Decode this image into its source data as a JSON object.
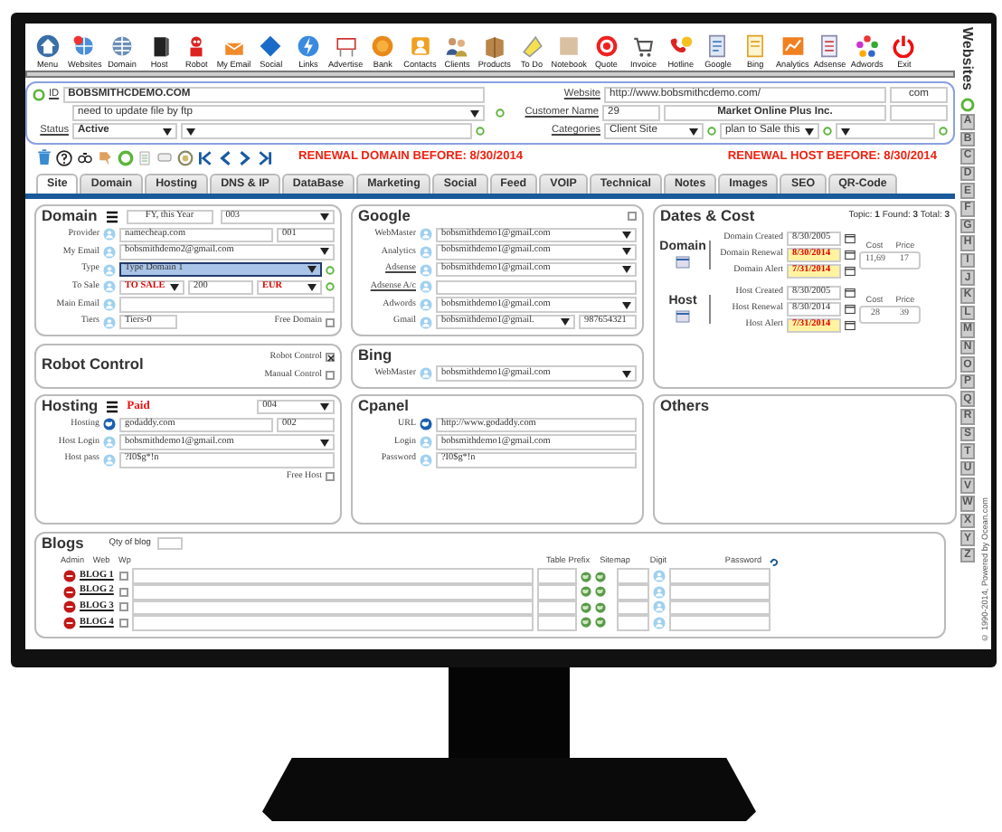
{
  "toolbar": [
    {
      "label": "Menu"
    },
    {
      "label": "Websites"
    },
    {
      "label": "Domain"
    },
    {
      "label": "Host"
    },
    {
      "label": "Robot"
    },
    {
      "label": "My Email"
    },
    {
      "label": "Social"
    },
    {
      "label": "Links"
    },
    {
      "label": "Advertise"
    },
    {
      "label": "Bank"
    },
    {
      "label": "Contacts"
    },
    {
      "label": "Clients"
    },
    {
      "label": "Products"
    },
    {
      "label": "To Do"
    },
    {
      "label": "Notebook"
    },
    {
      "label": "Quote"
    },
    {
      "label": "Invoice"
    },
    {
      "label": "Hotline"
    },
    {
      "label": "Google"
    },
    {
      "label": "Bing"
    },
    {
      "label": "Analytics"
    },
    {
      "label": "Adsense"
    },
    {
      "label": "Adwords"
    },
    {
      "label": "Exit"
    }
  ],
  "header": {
    "id_label": "ID",
    "id": "BOBSMITHCDEMO.COM",
    "note": "need to update file by ftp",
    "status_label": "Status",
    "status": "Active",
    "website_label": "Website",
    "website": "http://www.bobsmithcdemo.com/",
    "tld": "com",
    "customer_label": "Customer Name",
    "customer_no": "29",
    "customer": "Market Online Plus Inc.",
    "categories_label": "Categories",
    "category_1": "Client Site",
    "category_2": "plan to Sale this",
    "side_tab": "Websites"
  },
  "renewal_domain": "RENEWAL DOMAIN BEFORE: 8/30/2014",
  "renewal_host": "RENEWAL HOST BEFORE: 8/30/2014",
  "tabs": [
    {
      "label": "Site",
      "selected": true
    },
    {
      "label": "Domain",
      "selected": false
    },
    {
      "label": "Hosting",
      "selected": false
    },
    {
      "label": "DNS & IP",
      "selected": false
    },
    {
      "label": "DataBase",
      "selected": false
    },
    {
      "label": "Marketing",
      "selected": false
    },
    {
      "label": "Social",
      "selected": false
    },
    {
      "label": "Feed",
      "selected": false
    },
    {
      "label": "VOIP",
      "selected": false
    },
    {
      "label": "Technical",
      "selected": false
    },
    {
      "label": "Notes",
      "selected": false
    },
    {
      "label": "Images",
      "selected": false
    },
    {
      "label": "SEO",
      "selected": false
    },
    {
      "label": "QR-Code",
      "selected": false
    }
  ],
  "domain": {
    "title": "Domain",
    "period": "FY, this Year",
    "code": "003",
    "rows": [
      {
        "label": "Provider",
        "fields": [
          {
            "kind": "text",
            "value": "namecheap.com"
          },
          {
            "kind": "code",
            "value": "001"
          }
        ]
      },
      {
        "label": "My Email",
        "fields": [
          {
            "kind": "select",
            "value": "bobsmithdemo2@gmail.com"
          }
        ]
      },
      {
        "label": "Type",
        "add_button": true,
        "fields": [
          {
            "kind": "select",
            "value": "Type Domain 1",
            "focused": true
          }
        ]
      },
      {
        "label": "To Sale",
        "add_button": true,
        "fields": [
          {
            "kind": "select",
            "value": "TO SALE",
            "alert": true
          },
          {
            "kind": "text",
            "value": "200"
          },
          {
            "kind": "select",
            "value": "EUR",
            "alert": true
          }
        ]
      },
      {
        "label": "Main Email",
        "fields": [
          {
            "kind": "text"
          }
        ]
      },
      {
        "label": "Tiers",
        "fields": [
          {
            "kind": "code",
            "value": "Tiers-0"
          }
        ],
        "checkbox": {
          "label": "Free Domain",
          "checked": false
        }
      }
    ]
  },
  "robot": {
    "title": "Robot Control",
    "options": [
      {
        "label": "Robot Control",
        "checked": true
      },
      {
        "label": "Manual Control",
        "checked": false
      }
    ]
  },
  "hosting": {
    "title": "Hosting",
    "payment": "Paid",
    "code": "004",
    "rows": [
      {
        "label": "Hosting",
        "fields": [
          {
            "kind": "text",
            "value": "godaddy.com"
          },
          {
            "kind": "code",
            "value": "002"
          }
        ]
      },
      {
        "label": "Host Login",
        "fields": [
          {
            "kind": "select",
            "value": "bobsmithdemo1@gmail.com"
          }
        ]
      },
      {
        "label": "Host pass",
        "fields": [
          {
            "kind": "text",
            "value": "?I0$g*!n"
          }
        ]
      }
    ],
    "checkbox": {
      "label": "Free Host",
      "checked": false
    }
  },
  "google": {
    "title": "Google",
    "checked": false,
    "rows": [
      {
        "label": "WebMaster",
        "fields": [
          {
            "kind": "select",
            "value": "bobsmithdemo1@gmail.com"
          }
        ]
      },
      {
        "label": "Analytics",
        "fields": [
          {
            "kind": "select",
            "value": "bobsmithdemo1@gmail.com"
          }
        ]
      },
      {
        "label": "Adsense",
        "link": true,
        "fields": [
          {
            "kind": "select",
            "value": "bobsmithdemo1@gmail.com"
          }
        ]
      },
      {
        "label": "Adsense A/c",
        "link": true,
        "fields": [
          {
            "kind": "text"
          }
        ]
      },
      {
        "label": "Adwords",
        "fields": [
          {
            "kind": "select",
            "value": "bobsmithdemo1@gmail.com"
          }
        ]
      },
      {
        "label": "Gmail",
        "fields": [
          {
            "kind": "select",
            "value": "bobsmithdemo1@gmail."
          },
          {
            "kind": "code",
            "value": "987654321"
          }
        ]
      }
    ]
  },
  "bing": {
    "title": "Bing",
    "rows": [
      {
        "label": "WebMaster",
        "fields": [
          {
            "kind": "select",
            "value": "bobsmithdemo1@gmail.com"
          }
        ]
      }
    ]
  },
  "cpanel": {
    "title": "Cpanel",
    "rows": [
      {
        "label": "URL",
        "fields": [
          {
            "value": "http://www.godaddy.com"
          }
        ]
      },
      {
        "label": "Login",
        "fields": [
          {
            "value": "bobsmithdemo1@gmail.com"
          }
        ]
      },
      {
        "label": "Password",
        "fields": [
          {
            "value": "?I0$g*!n"
          }
        ]
      }
    ]
  },
  "dates": {
    "title": "Dates & Cost",
    "summary": "Topic: **1** Found: **3** Total: **3**",
    "groups": [
      {
        "title": "Domain",
        "cost_label": "Cost",
        "price_label": "Price",
        "cost": "11,69",
        "price": "17",
        "rows": [
          {
            "label": "Domain Created",
            "value": "8/30/2005",
            "alert": false
          },
          {
            "label": "Domain Renewal",
            "value": "8/30/2014",
            "alert": true
          },
          {
            "label": "Domain Alert",
            "value": "7/31/2014",
            "alert": true
          }
        ]
      },
      {
        "title": "Host",
        "cost_label": "Cost",
        "price_label": "Price",
        "cost": "28",
        "price": "39",
        "rows": [
          {
            "label": "Host Created",
            "value": "8/30/2005",
            "alert": false
          },
          {
            "label": "Host Renewal",
            "value": "8/30/2014",
            "alert": false
          },
          {
            "label": "Host Alert",
            "value": "7/31/2014",
            "alert": true
          }
        ]
      }
    ]
  },
  "others": {
    "title": "Others"
  },
  "blogs": {
    "title": "Blogs",
    "qty_label": "Qty of blog",
    "columns": [
      "Admin",
      "Web",
      "Wp",
      "Table Prefix",
      "Sitemap",
      "Digit",
      "Password"
    ],
    "rows": [
      {
        "name": "BLOG 1",
        "wp": false
      },
      {
        "name": "BLOG 2",
        "wp": false
      },
      {
        "name": "BLOG 3",
        "wp": false
      },
      {
        "name": "BLOG 4",
        "wp": false
      }
    ]
  },
  "letters": [
    "A",
    "B",
    "C",
    "D",
    "E",
    "F",
    "G",
    "H",
    "I",
    "J",
    "K",
    "L",
    "M",
    "N",
    "O",
    "P",
    "Q",
    "R",
    "S",
    "T",
    "U",
    "V",
    "W",
    "X",
    "Y",
    "Z"
  ],
  "copyright": "© 1990-2014, Powered by Ocean.com"
}
